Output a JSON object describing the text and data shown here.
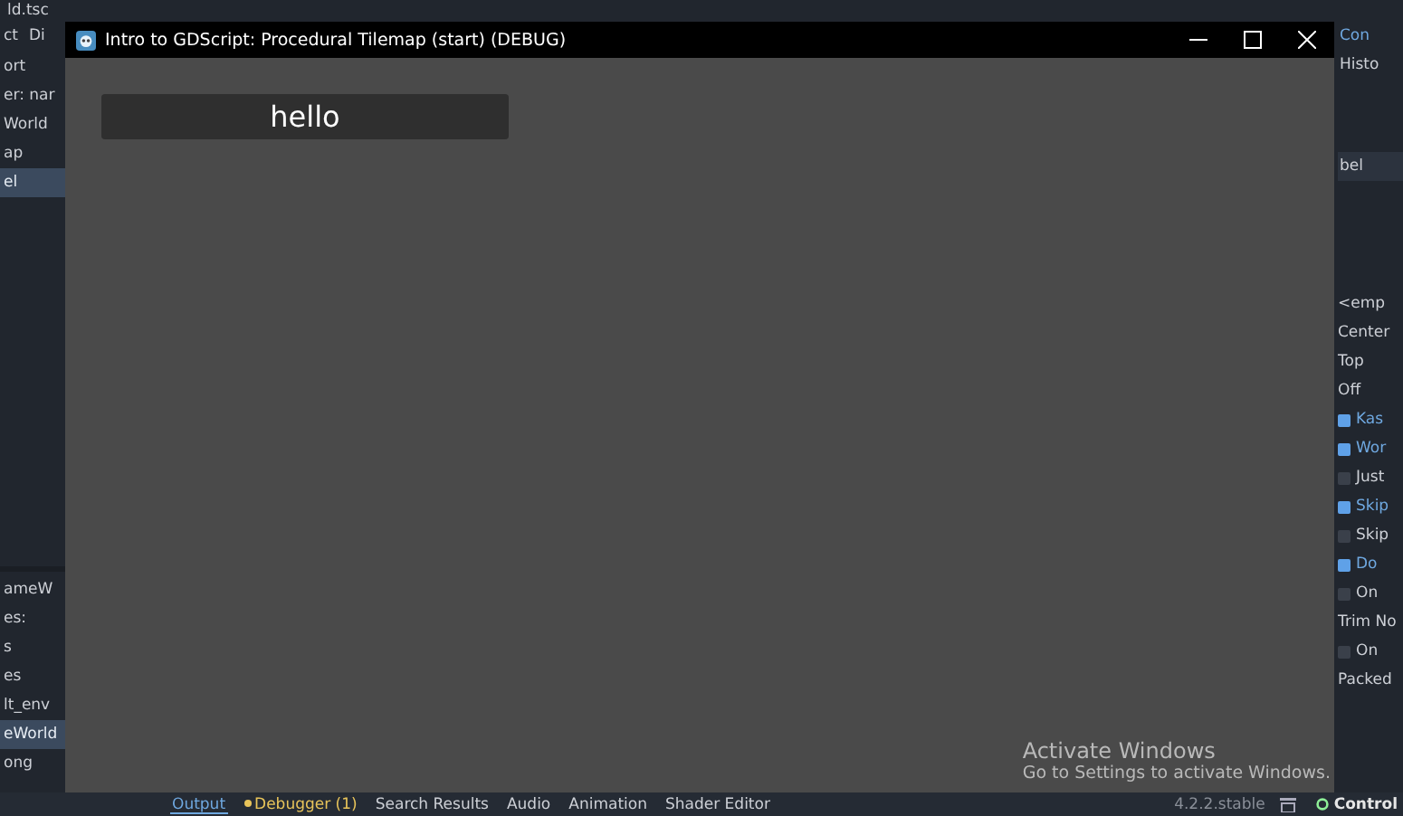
{
  "editor": {
    "scene_tab": "ld.tsc",
    "menu": [
      "ct",
      "Di"
    ],
    "left_panels": [
      {
        "items": [
          {
            "label": "ort",
            "selected": false
          },
          {
            "label": "er: nar",
            "selected": false
          },
          {
            "label": "World",
            "selected": false
          },
          {
            "label": "ap",
            "selected": false
          },
          {
            "label": "el",
            "selected": true
          }
        ]
      },
      {
        "items": [
          {
            "label": "ameW",
            "selected": false
          },
          {
            "label": "es:",
            "selected": false
          },
          {
            "label": "s",
            "selected": false
          },
          {
            "label": "es",
            "selected": false
          },
          {
            "label": "lt_env",
            "selected": false
          },
          {
            "label": "eWorld",
            "selected": true
          },
          {
            "label": "ong",
            "selected": false
          }
        ]
      }
    ],
    "right_tabs": [
      {
        "label": "Con",
        "selected": true
      },
      {
        "label": "Histo",
        "selected": false
      }
    ],
    "node_header": "bel",
    "inspector_rows": [
      {
        "kind": "value",
        "label": "<emp"
      },
      {
        "kind": "value",
        "label": "Center"
      },
      {
        "kind": "value",
        "label": "Top"
      },
      {
        "kind": "value",
        "label": "Off"
      },
      {
        "kind": "check",
        "label": "Kas",
        "checked": true
      },
      {
        "kind": "check",
        "label": "Wor",
        "checked": true
      },
      {
        "kind": "check",
        "label": "Just",
        "checked": false
      },
      {
        "kind": "check",
        "label": "Skip",
        "checked": true
      },
      {
        "kind": "check",
        "label": "Skip",
        "checked": false
      },
      {
        "kind": "check",
        "label": "Do",
        "checked": true
      },
      {
        "kind": "check",
        "label": "On",
        "checked": false
      },
      {
        "kind": "value",
        "label": "Trim No"
      },
      {
        "kind": "check",
        "label": "On",
        "checked": false
      },
      {
        "kind": "value",
        "label": "Packed"
      }
    ],
    "bottom_tabs": [
      {
        "label": "Output",
        "selected": true,
        "alert": false
      },
      {
        "label": "Debugger (1)",
        "selected": false,
        "alert": true
      },
      {
        "label": "Search Results",
        "selected": false,
        "alert": false
      },
      {
        "label": "Audio",
        "selected": false,
        "alert": false
      },
      {
        "label": "Animation",
        "selected": false,
        "alert": false
      },
      {
        "label": "Shader Editor",
        "selected": false,
        "alert": false
      }
    ],
    "version": "4.2.2.stable",
    "node_type": "Control"
  },
  "game_window": {
    "title": "Intro to GDScript: Procedural Tilemap (start) (DEBUG)",
    "label": "hello"
  },
  "os_notice": {
    "title": "Activate Windows",
    "subtitle": "Go to Settings to activate Windows."
  }
}
